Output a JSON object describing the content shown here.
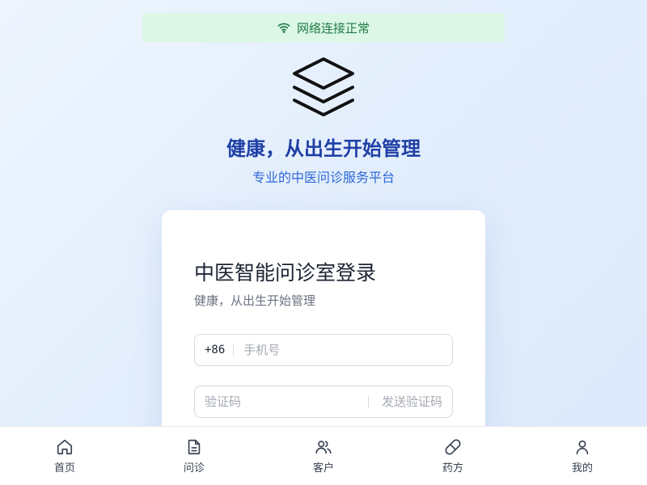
{
  "network_banner": {
    "icon": "wifi-icon",
    "text": "网络连接正常",
    "bg_color": "#dcf7e6",
    "text_color": "#1e7a45"
  },
  "logo": {
    "icon": "layers-icon"
  },
  "hero": {
    "title": "健康，从出生开始管理",
    "subtitle": "专业的中医问诊服务平台",
    "title_color": "#1f3fa6",
    "subtitle_color": "#2f67d6"
  },
  "login_card": {
    "title": "中医智能问诊室登录",
    "subtitle": "健康，从出生开始管理",
    "phone_field": {
      "prefix": "+86",
      "placeholder": "手机号",
      "value": ""
    },
    "code_field": {
      "placeholder": "验证码",
      "value": "",
      "send_code_label": "发送验证码"
    }
  },
  "tab_bar": {
    "items": [
      {
        "label": "首页",
        "icon": "home-icon"
      },
      {
        "label": "问诊",
        "icon": "document-icon"
      },
      {
        "label": "客户",
        "icon": "users-icon"
      },
      {
        "label": "药方",
        "icon": "pill-icon"
      },
      {
        "label": "我的",
        "icon": "user-icon"
      }
    ]
  }
}
